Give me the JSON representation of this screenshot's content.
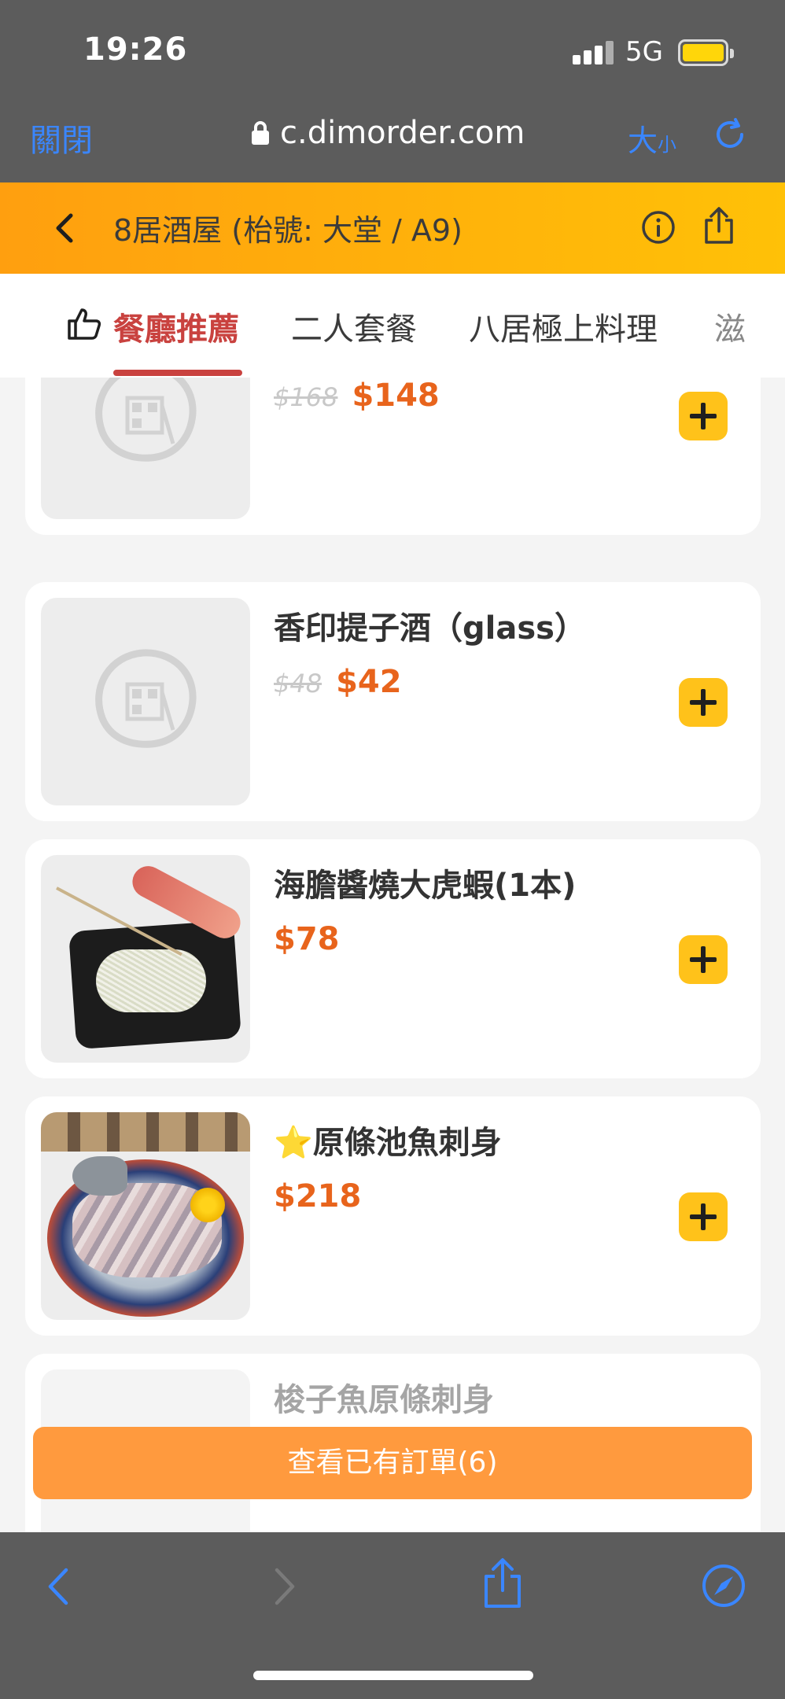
{
  "status_bar": {
    "time": "19:26",
    "network": "5G"
  },
  "browser": {
    "close_label": "關閉",
    "url": "c.dimorder.com",
    "textsize_big": "大",
    "textsize_small": "小"
  },
  "restaurant": {
    "title": "8居酒屋 (枱號: 大堂 / A9)"
  },
  "tabs": [
    {
      "label": "餐廳推薦",
      "active": true
    },
    {
      "label": "二人套餐"
    },
    {
      "label": "八居極上料理"
    },
    {
      "label": "滋"
    }
  ],
  "menu_items": [
    {
      "name": "",
      "old_price": "$168",
      "price": "$148",
      "image": "placeholder"
    },
    {
      "name": "香印提子酒（glass）",
      "old_price": "$48",
      "price": "$42",
      "image": "placeholder"
    },
    {
      "name": "海膽醬燒大虎蝦(1本)",
      "price": "$78",
      "image": "shrimp-photo"
    },
    {
      "name": "⭐原條池魚刺身",
      "price": "$218",
      "image": "fish-sashimi-photo"
    },
    {
      "name": "梭子魚原條刺身",
      "image": "barracuda-photo"
    }
  ],
  "order_bar": {
    "label": "查看已有訂單(6)"
  },
  "colors": {
    "accent_orange": "#ff9f0f",
    "price_orange": "#e8641c",
    "tab_active_red": "#c9423f",
    "add_button_yellow": "#ffc21a",
    "link_blue": "#3a86ff"
  },
  "icons": [
    "lock-icon",
    "reload-icon",
    "back-icon",
    "info-icon",
    "share-icon",
    "thumbs-up-icon",
    "plus-icon",
    "compass-icon"
  ]
}
